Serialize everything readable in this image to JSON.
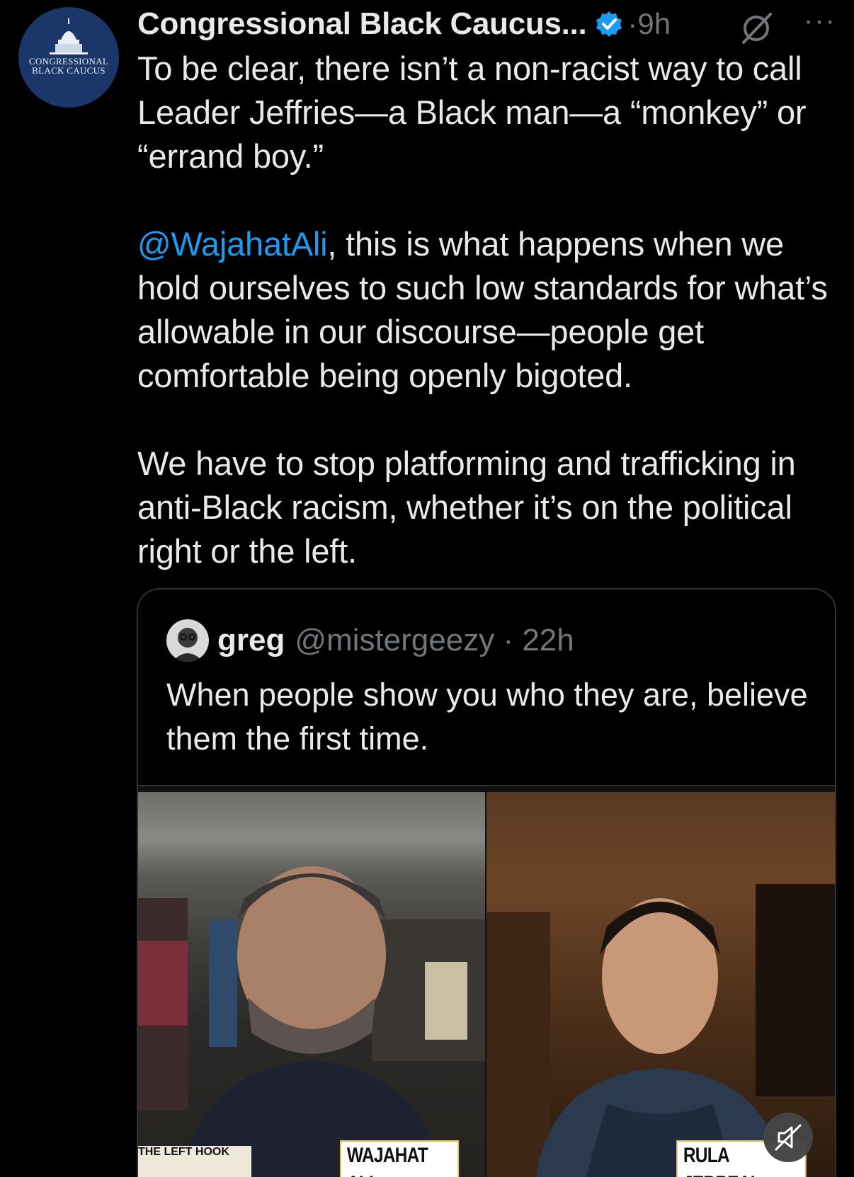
{
  "author": {
    "display_name": "Congressional Black Caucus...",
    "time": "9h",
    "avatar_text": "CONGRESSIONAL BLACK CAUCUS"
  },
  "tweet": {
    "line1": "To be clear, there isn’t a non-racist way to call Leader Jeffries—a Black man—a “monkey” or “errand boy.”",
    "mention": "@WajahatAli",
    "line2": ", this is what happens when we hold ourselves to such low standards for what’s allowable in our discourse—people get comfortable being openly bigoted.",
    "line3": "We have to stop platforming and trafficking in anti-Black racism, whether it’s on the political right or the left."
  },
  "quoted": {
    "name": "greg",
    "handle": "@mistergeezy",
    "time": "22h",
    "text": "When people show you who they are, believe them the first time.",
    "media": {
      "left_name": "WAJAHAT ALI",
      "right_name": "RULA JEBREAL",
      "show_logo": "THE LEFT HOOK"
    }
  },
  "colors": {
    "accent": "#1d9bf0",
    "secondary": "#71767b",
    "border": "#2f3336"
  },
  "icons": [
    "verified-badge-icon",
    "grok-icon",
    "more-icon",
    "mute-icon"
  ]
}
